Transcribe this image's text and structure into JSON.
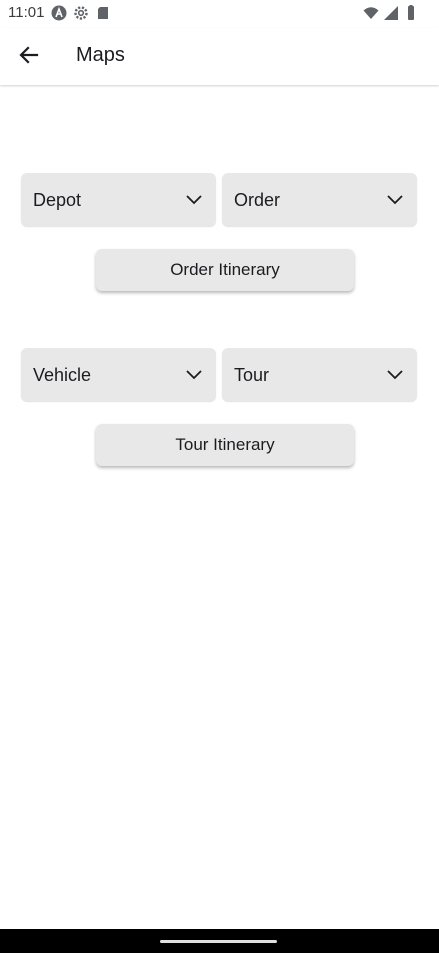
{
  "status_bar": {
    "time": "11:01",
    "left_icons": [
      "a-badge-icon",
      "settings-gear-icon",
      "sd-card-icon"
    ],
    "right_icons": [
      "wifi-icon",
      "signal-icon",
      "battery-icon"
    ]
  },
  "app_bar": {
    "title": "Maps",
    "back_icon": "arrow-back-icon"
  },
  "order_section": {
    "depot_dropdown": {
      "selected": "Depot",
      "icon": "chevron-down-icon"
    },
    "order_dropdown": {
      "selected": "Order",
      "icon": "chevron-down-icon"
    },
    "itinerary_button": "Order Itinerary"
  },
  "tour_section": {
    "vehicle_dropdown": {
      "selected": "Vehicle",
      "icon": "chevron-down-icon"
    },
    "tour_dropdown": {
      "selected": "Tour",
      "icon": "chevron-down-icon"
    },
    "itinerary_button": "Tour Itinerary"
  },
  "colors": {
    "control_bg": "#e8e8e8",
    "text": "#1c1b1f",
    "nav_bar": "#000000"
  }
}
